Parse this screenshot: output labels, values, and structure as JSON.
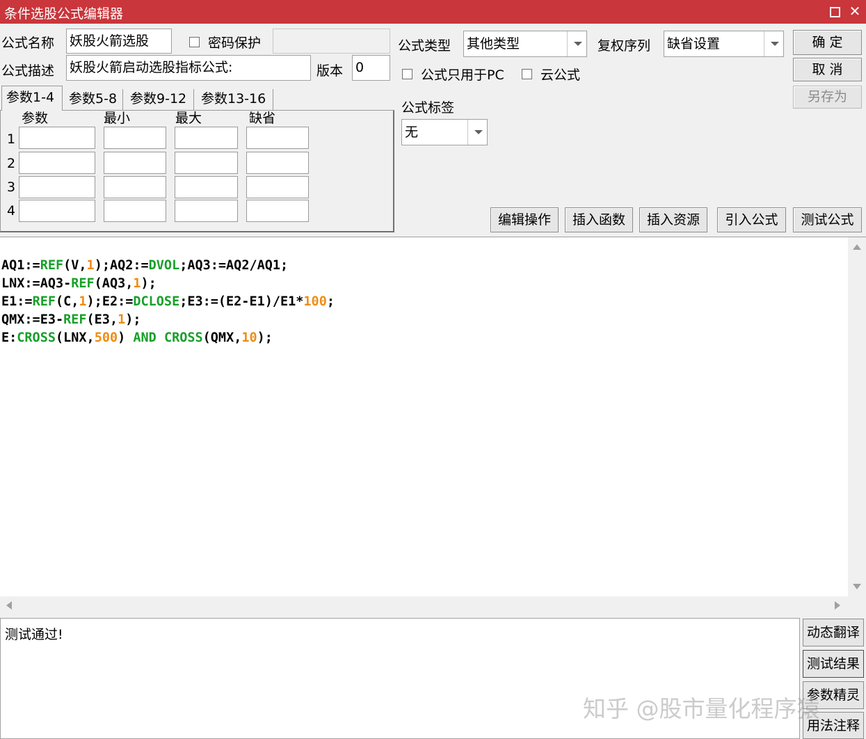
{
  "window": {
    "title": "条件选股公式编辑器",
    "maximize_label": "□",
    "close_label": "✕"
  },
  "form": {
    "name_label": "公式名称",
    "name_value": "妖股火箭选股",
    "password_label": "密码保护",
    "desc_label": "公式描述",
    "desc_value": "妖股火箭启动选股指标公式:",
    "version_label": "版本",
    "version_value": "0",
    "type_label": "公式类型",
    "type_value": "其他类型",
    "restore_label": "复权序列",
    "restore_value": "缺省设置",
    "pc_only_label": "公式只用于PC",
    "cloud_label": "云公式",
    "tag_label": "公式标签",
    "tag_value": "无"
  },
  "buttons": {
    "ok": "确  定",
    "cancel": "取  消",
    "save_as": "另存为",
    "edit_ops": "编辑操作",
    "insert_func": "插入函数",
    "insert_res": "插入资源",
    "import_formula": "引入公式",
    "test_formula": "测试公式"
  },
  "params": {
    "tabs": [
      "参数1-4",
      "参数5-8",
      "参数9-12",
      "参数13-16"
    ],
    "columns": [
      "参数",
      "最小",
      "最大",
      "缺省"
    ],
    "rows": [
      "1",
      "2",
      "3",
      "4"
    ]
  },
  "code": {
    "line1": {
      "a": "AQ1:=",
      "b": "REF",
      "c": "(V,",
      "d": "1",
      "e": ");AQ2:=",
      "f": "DVOL",
      "g": ";AQ3:=AQ2/AQ1;"
    },
    "line2": {
      "a": "LNX:=AQ3-",
      "b": "REF",
      "c": "(AQ3,",
      "d": "1",
      "e": ");"
    },
    "line3": {
      "a": "E1:=",
      "b": "REF",
      "c": "(C,",
      "d": "1",
      "e": ");E2:=",
      "f": "DCLOSE",
      "g": ";E3:=(E2-E1)/E1*",
      "h": "100",
      "i": ";"
    },
    "line4": {
      "a": "QMX:=E3-",
      "b": "REF",
      "c": "(E3,",
      "d": "1",
      "e": ");"
    },
    "line5": {
      "a": "E:",
      "b": "CROSS",
      "c": "(LNX,",
      "d": "500",
      "e": ") ",
      "f": "AND",
      "g": " ",
      "h": "CROSS",
      "i": "(QMX,",
      "j": "10",
      "k": ");"
    }
  },
  "output": {
    "message": "测试通过!"
  },
  "side_buttons": [
    "动态翻译",
    "测试结果",
    "参数精灵",
    "用法注释"
  ],
  "watermark": "知乎 @股市量化程序猿",
  "colors": {
    "titlebar": "#c9363b",
    "function": "#18a02a",
    "number": "#f08c14"
  }
}
